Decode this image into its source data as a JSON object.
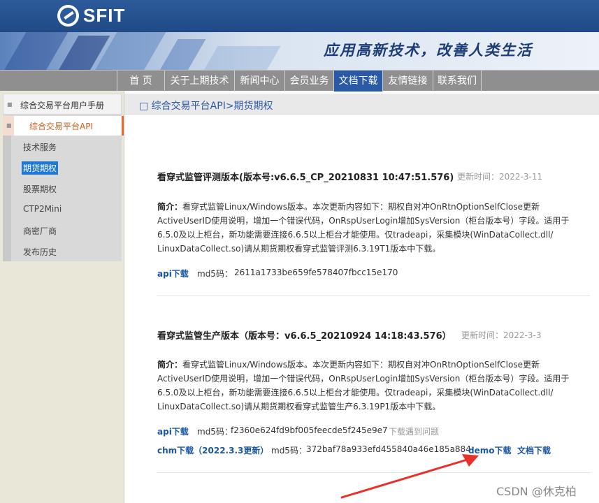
{
  "header": {
    "logo_text": "SFIT",
    "slogan": "应用高新技术，改善人类生活"
  },
  "nav": {
    "items": [
      "首 页",
      "关于上期技术",
      "新闻中心",
      "会员业务",
      "文档下载",
      "友情链接",
      "联系我们"
    ],
    "active": "文档下载"
  },
  "sidebar": {
    "head": "综合交易平台用户手册",
    "active": "综合交易平台API",
    "items": [
      "技术服务",
      "期货期权",
      "股票期权",
      "CTP2Mini",
      "商密厂商",
      "发布历史"
    ],
    "selected": "期货期权"
  },
  "breadcrumb": "□ 综合交易平台API>期货期权",
  "entries": [
    {
      "title": "看穿式监管评测版本(版本号:v6.6.5_CP_20210831 10:47:51.576)",
      "date": "更新时间：2022-3-11",
      "desc_label": "简介：",
      "desc": "看穿式监管Linux/Windows版本。本次更新内容如下：期权自对冲OnRtnOptionSelfClose更新ActiveUserID使用说明，增加一个错误代码，OnRspUserLogin增加SysVersion（柜台版本号）字段。适用于6.5.0及以上柜台，新功能需要连接6.6.5以上柜台才能使用。仅tradeapi，采集模块(WinDataCollect.dll/ LinuxDataCollect.so)请从期货期权看穿式监管评测6.3.19T1版本中下载。",
      "api_link": "api下载",
      "md5_label": "md5码：",
      "md5": "2611a1733be659fe578407fbcc15e170"
    },
    {
      "title": "看穿式监管生产版本（版本号：v6.6.5_20210924 14:18:43.576）",
      "date": "更新时间：2022-3-3",
      "desc_label": "简介：",
      "desc": "看穿式监管Linux/Windows版本。本次更新内容如下：期权自对冲OnRtnOptionSelfClose更新ActiveUserID使用说明，增加一个错误代码，OnRspUserLogin增加SysVersion（柜台版本号）字段。适用于6.5.0及以上柜台，新功能需要连接6.6.5以上柜台才能使用。仅tradeapi，采集模块(WinDataCollect.dll/ LinuxDataCollect.so)请从期货期权看穿式监管生产6.3.19P1版本中下载。",
      "api_link": "api下载",
      "md5_label": "md5码：",
      "md5": "f2360e624fd9bf005feecde5f245e9e7",
      "problem_link": "下载遇到问题",
      "chm_link": "chm下载（2022.3.3更新）",
      "chm_md5_label": "md5码：",
      "chm_md5": "372baf78a933efd455840a46e185a884",
      "demo_link": "demo下载",
      "doc_link": "文档下载"
    }
  ],
  "watermark": "CSDN @休克柏",
  "colors": {
    "nav_active": "#2a59a5",
    "link": "#1a57a0",
    "sidebar_accent": "#e8682b",
    "annotation_arrow": "#e8312a"
  }
}
